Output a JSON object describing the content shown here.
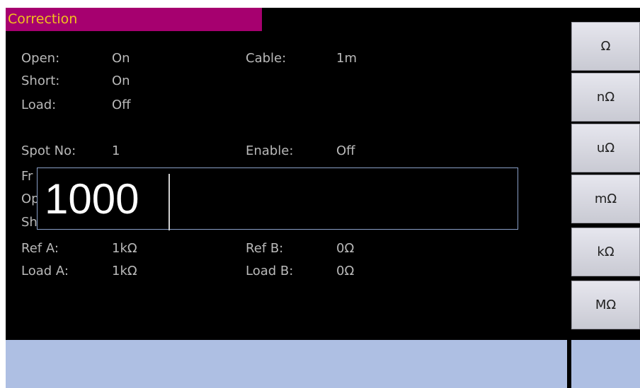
{
  "title": "Correction",
  "fields": {
    "open_label": "Open:",
    "open_value": "On",
    "short_label": "Short:",
    "short_value": "On",
    "load_label": "Load:",
    "load_value": "Off",
    "cable_label": "Cable:",
    "cable_value": "1m",
    "spot_label": "Spot No:",
    "spot_value": "1",
    "enable_label": "Enable:",
    "enable_value": "Off",
    "freq_label_partial": "Fr",
    "open2_label_partial": "Op",
    "short2_label_partial": "Sh",
    "refa_label": "Ref A:",
    "refa_value": "1kΩ",
    "refb_label": "Ref B:",
    "refb_value": "0Ω",
    "loada_label": "Load A:",
    "loada_value": "1kΩ",
    "loadb_label": "Load B:",
    "loadb_value": "0Ω"
  },
  "input": {
    "value": "1000"
  },
  "softkeys": [
    {
      "label": "Ω"
    },
    {
      "label": "nΩ"
    },
    {
      "label": "uΩ"
    },
    {
      "label": "mΩ"
    },
    {
      "label": "kΩ"
    },
    {
      "label": "MΩ"
    }
  ],
  "colors": {
    "title_bg": "#a6006f",
    "title_text": "#f2c21d",
    "label_text": "#b9b9b9",
    "bottom_bar": "#aebfe3"
  }
}
